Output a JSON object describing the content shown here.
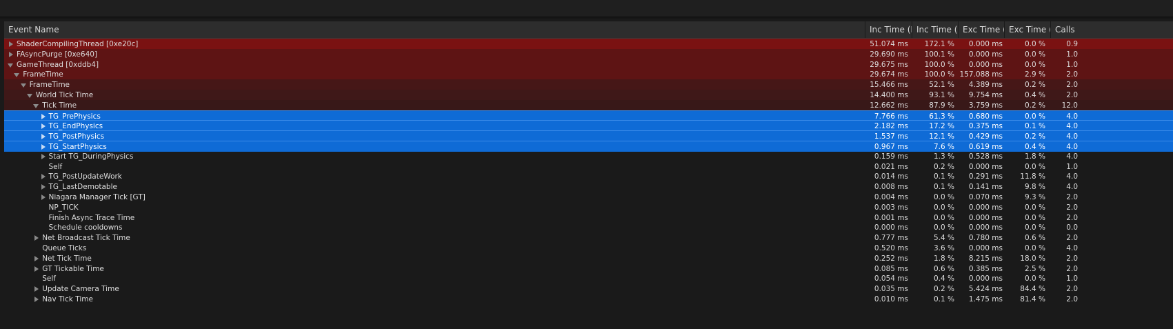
{
  "columns": [
    "Event Name",
    "Inc Time (M",
    "Inc Time (%",
    "Exc Time (M",
    "Exc Time (%",
    "Calls"
  ],
  "rows": [
    {
      "name": "ShaderCompilingThread [0xe20c]",
      "depth": 0,
      "exp": "right",
      "inc": "51.074 ms",
      "incp": "172.1 %",
      "exc": "0.000 ms",
      "excp": "0.0 %",
      "calls": "0.9",
      "bg": "#7a1212"
    },
    {
      "name": "FAsyncPurge [0xe640]",
      "depth": 0,
      "exp": "right",
      "inc": "29.690 ms",
      "incp": "100.1 %",
      "exc": "0.000 ms",
      "excp": "0.0 %",
      "calls": "1.0",
      "bg": "#5e1414"
    },
    {
      "name": "GameThread [0xddb4]",
      "depth": 0,
      "exp": "down",
      "inc": "29.675 ms",
      "incp": "100.0 %",
      "exc": "0.000 ms",
      "excp": "0.0 %",
      "calls": "1.0",
      "bg": "#5e1414"
    },
    {
      "name": "FrameTime",
      "depth": 1,
      "exp": "down",
      "inc": "29.674 ms",
      "incp": "100.0 %",
      "exc": "157.088 ms",
      "excp": "2.9 %",
      "calls": "2.0",
      "bg": "#5e1414"
    },
    {
      "name": "FrameTime",
      "depth": 2,
      "exp": "down",
      "inc": "15.466 ms",
      "incp": "52.1 %",
      "exc": "4.389 ms",
      "excp": "0.2 %",
      "calls": "2.0",
      "bg": "#461717"
    },
    {
      "name": "World Tick Time",
      "depth": 3,
      "exp": "down",
      "inc": "14.400 ms",
      "incp": "93.1 %",
      "exc": "9.754 ms",
      "excp": "0.4 %",
      "calls": "2.0",
      "bg": "#3f1818"
    },
    {
      "name": "Tick Time",
      "depth": 4,
      "exp": "down",
      "inc": "12.662 ms",
      "incp": "87.9 %",
      "exc": "3.759 ms",
      "excp": "0.2 %",
      "calls": "12.0",
      "bg": "#381818"
    },
    {
      "name": "TG_PrePhysics",
      "depth": 5,
      "exp": "right",
      "inc": "7.766 ms",
      "incp": "61.3 %",
      "exc": "0.680 ms",
      "excp": "0.0 %",
      "calls": "4.0",
      "sel": true
    },
    {
      "name": "TG_EndPhysics",
      "depth": 5,
      "exp": "right",
      "inc": "2.182 ms",
      "incp": "17.2 %",
      "exc": "0.375 ms",
      "excp": "0.1 %",
      "calls": "4.0",
      "sel": true
    },
    {
      "name": "TG_PostPhysics",
      "depth": 5,
      "exp": "right",
      "inc": "1.537 ms",
      "incp": "12.1 %",
      "exc": "0.429 ms",
      "excp": "0.2 %",
      "calls": "4.0",
      "sel": true
    },
    {
      "name": "TG_StartPhysics",
      "depth": 5,
      "exp": "right",
      "inc": "0.967 ms",
      "incp": "7.6 %",
      "exc": "0.619 ms",
      "excp": "0.4 %",
      "calls": "4.0",
      "sel": true
    },
    {
      "name": "Start TG_DuringPhysics",
      "depth": 5,
      "exp": "right",
      "inc": "0.159 ms",
      "incp": "1.3 %",
      "exc": "0.528 ms",
      "excp": "1.8 %",
      "calls": "4.0"
    },
    {
      "name": "Self",
      "depth": 5,
      "exp": "none",
      "inc": "0.021 ms",
      "incp": "0.2 %",
      "exc": "0.000 ms",
      "excp": "0.0 %",
      "calls": "1.0"
    },
    {
      "name": "TG_PostUpdateWork",
      "depth": 5,
      "exp": "right",
      "inc": "0.014 ms",
      "incp": "0.1 %",
      "exc": "0.291 ms",
      "excp": "11.8 %",
      "calls": "4.0"
    },
    {
      "name": "TG_LastDemotable",
      "depth": 5,
      "exp": "right",
      "inc": "0.008 ms",
      "incp": "0.1 %",
      "exc": "0.141 ms",
      "excp": "9.8 %",
      "calls": "4.0"
    },
    {
      "name": "Niagara Manager Tick [GT]",
      "depth": 5,
      "exp": "right",
      "inc": "0.004 ms",
      "incp": "0.0 %",
      "exc": "0.070 ms",
      "excp": "9.3 %",
      "calls": "2.0"
    },
    {
      "name": "NP_TICK",
      "depth": 5,
      "exp": "none",
      "inc": "0.003 ms",
      "incp": "0.0 %",
      "exc": "0.000 ms",
      "excp": "0.0 %",
      "calls": "2.0"
    },
    {
      "name": "Finish Async Trace Time",
      "depth": 5,
      "exp": "none",
      "inc": "0.001 ms",
      "incp": "0.0 %",
      "exc": "0.000 ms",
      "excp": "0.0 %",
      "calls": "2.0"
    },
    {
      "name": "Schedule cooldowns",
      "depth": 5,
      "exp": "none",
      "inc": "0.000 ms",
      "incp": "0.0 %",
      "exc": "0.000 ms",
      "excp": "0.0 %",
      "calls": "0.0"
    },
    {
      "name": "Net Broadcast Tick Time",
      "depth": 4,
      "exp": "right",
      "inc": "0.777 ms",
      "incp": "5.4 %",
      "exc": "0.780 ms",
      "excp": "0.6 %",
      "calls": "2.0"
    },
    {
      "name": "Queue Ticks",
      "depth": 4,
      "exp": "none",
      "inc": "0.520 ms",
      "incp": "3.6 %",
      "exc": "0.000 ms",
      "excp": "0.0 %",
      "calls": "4.0"
    },
    {
      "name": "Net Tick Time",
      "depth": 4,
      "exp": "right",
      "inc": "0.252 ms",
      "incp": "1.8 %",
      "exc": "8.215 ms",
      "excp": "18.0 %",
      "calls": "2.0"
    },
    {
      "name": "GT Tickable Time",
      "depth": 4,
      "exp": "right",
      "inc": "0.085 ms",
      "incp": "0.6 %",
      "exc": "0.385 ms",
      "excp": "2.5 %",
      "calls": "2.0"
    },
    {
      "name": "Self",
      "depth": 4,
      "exp": "none",
      "inc": "0.054 ms",
      "incp": "0.4 %",
      "exc": "0.000 ms",
      "excp": "0.0 %",
      "calls": "1.0"
    },
    {
      "name": "Update Camera Time",
      "depth": 4,
      "exp": "right",
      "inc": "0.035 ms",
      "incp": "0.2 %",
      "exc": "5.424 ms",
      "excp": "84.4 %",
      "calls": "2.0"
    },
    {
      "name": "Nav Tick Time",
      "depth": 4,
      "exp": "right",
      "inc": "0.010 ms",
      "incp": "0.1 %",
      "exc": "1.475 ms",
      "excp": "81.4 %",
      "calls": "2.0"
    }
  ]
}
